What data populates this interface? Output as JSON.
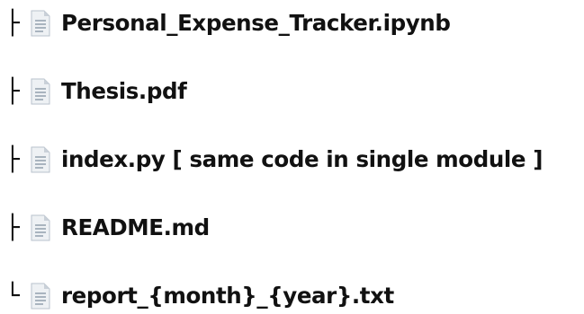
{
  "tree": {
    "items": [
      {
        "connector": "├",
        "icon": "file-icon",
        "name": "Personal_Expense_Tracker.ipynb"
      },
      {
        "connector": "├",
        "icon": "file-icon",
        "name": "Thesis.pdf"
      },
      {
        "connector": "├",
        "icon": "file-icon",
        "name": "index.py [ same code in single module ]"
      },
      {
        "connector": "├",
        "icon": "file-icon",
        "name": "README.md"
      },
      {
        "connector": "└",
        "icon": "file-icon",
        "name": "report_{month}_{year}.txt"
      }
    ]
  },
  "colors": {
    "text": "#111111",
    "icon_page": "#eef1f4",
    "icon_fold": "#c9d0d8",
    "icon_lines": "#a9b4bf"
  }
}
